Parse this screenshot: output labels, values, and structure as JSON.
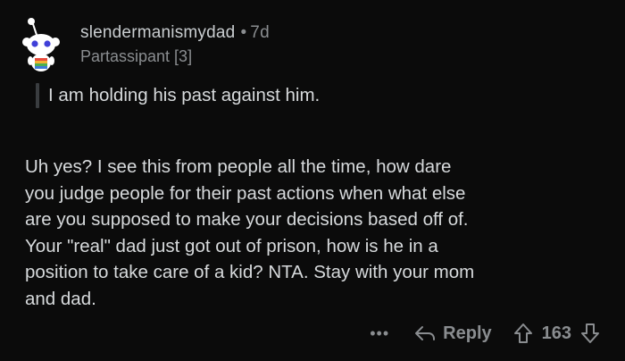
{
  "comment": {
    "author": "slendermanismydad",
    "separator": "•",
    "timestamp": "7d",
    "flair": "Partassipant [3]",
    "quote": "I am holding his past against him.",
    "body_lines": [
      "Uh yes? I see this from people all the time, how dare",
      "you judge people for their past actions when what else",
      "are you supposed to make your decisions based off of.",
      "Your \"real\" dad just got out of prison, how is he in a",
      "position to take care of a kid? NTA. Stay with your mom",
      "and dad."
    ]
  },
  "actions": {
    "more_label": "•••",
    "reply_label": "Reply",
    "vote_count": "163",
    "icons": {
      "reply": "reply-arrow-icon",
      "upvote": "upvote-arrow-icon",
      "downvote": "downvote-arrow-icon"
    }
  },
  "colors": {
    "background": "#0b0b0b",
    "text": "#d7dadc",
    "muted": "#8a8d90",
    "quote_bar": "#3a3d40"
  }
}
